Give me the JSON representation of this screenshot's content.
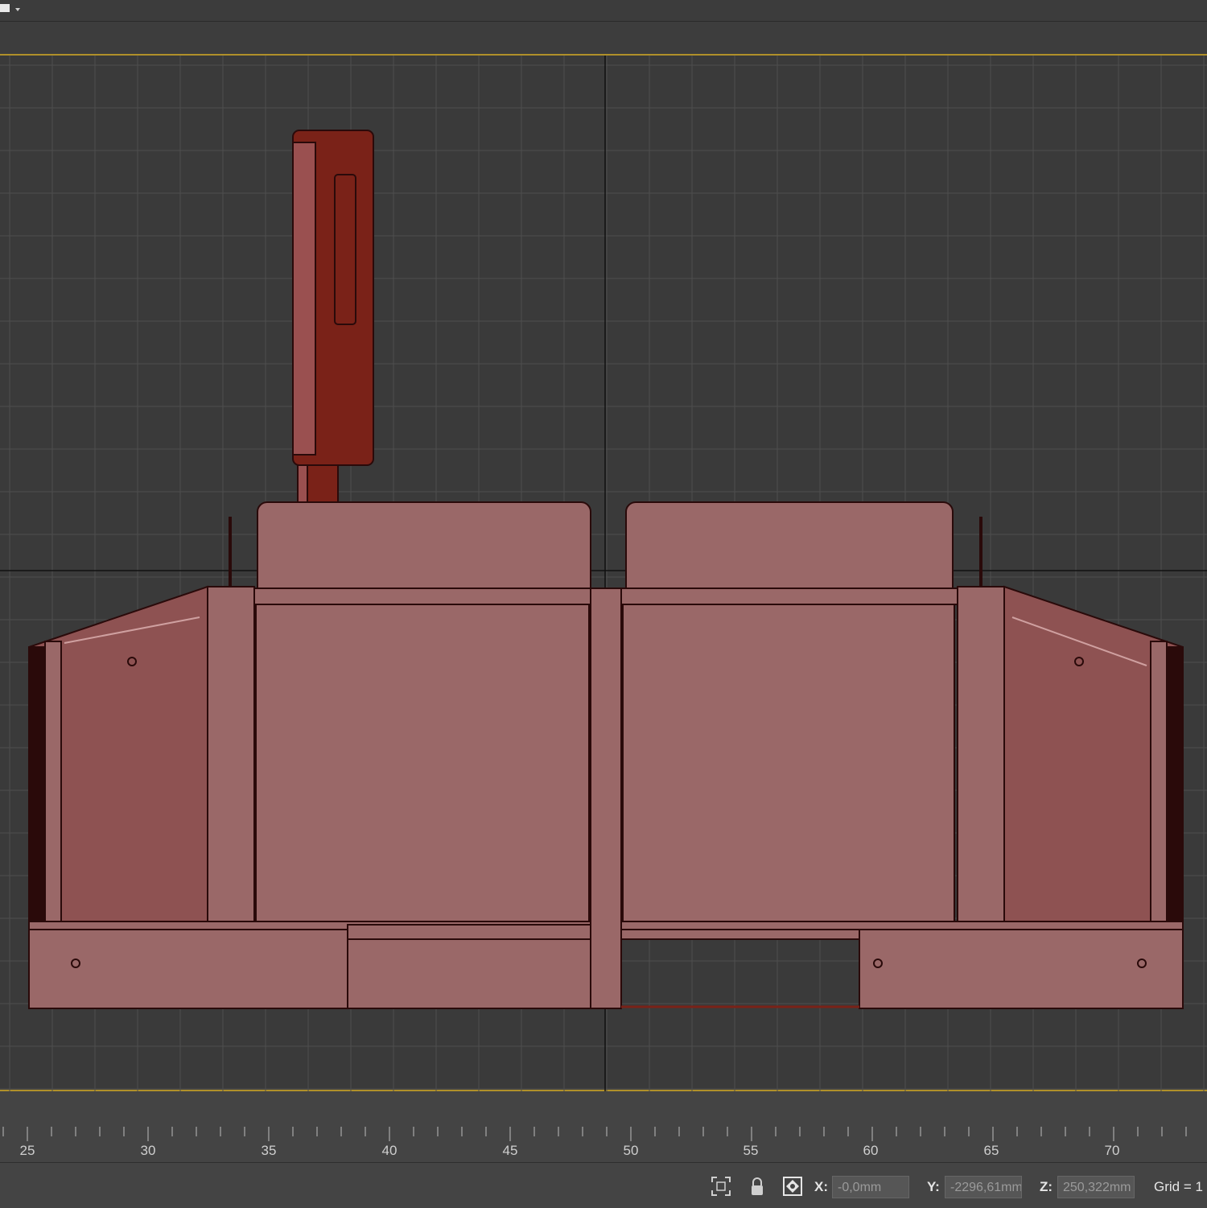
{
  "window": {
    "menu_icon": "viewport-menu-icon"
  },
  "viewport": {
    "background": "#3a3a3a",
    "grid_color": "#4e4e4e",
    "axis_color": "#111111",
    "border_color": "#b0902a",
    "object_color": "#9a6868",
    "object_dark_color": "#7a2218"
  },
  "timeline": {
    "ticks": [
      "25",
      "30",
      "35",
      "40",
      "45",
      "50",
      "55",
      "60",
      "65",
      "70"
    ]
  },
  "statusbar": {
    "x_label": "X:",
    "x_value": "-0,0mm",
    "y_label": "Y:",
    "y_value": "-2296,61mm",
    "z_label": "Z:",
    "z_value": "250,322mm",
    "grid_text": "Grid = 1",
    "icons": [
      "selection-region-icon",
      "lock-icon",
      "absolute-mode-icon"
    ]
  }
}
